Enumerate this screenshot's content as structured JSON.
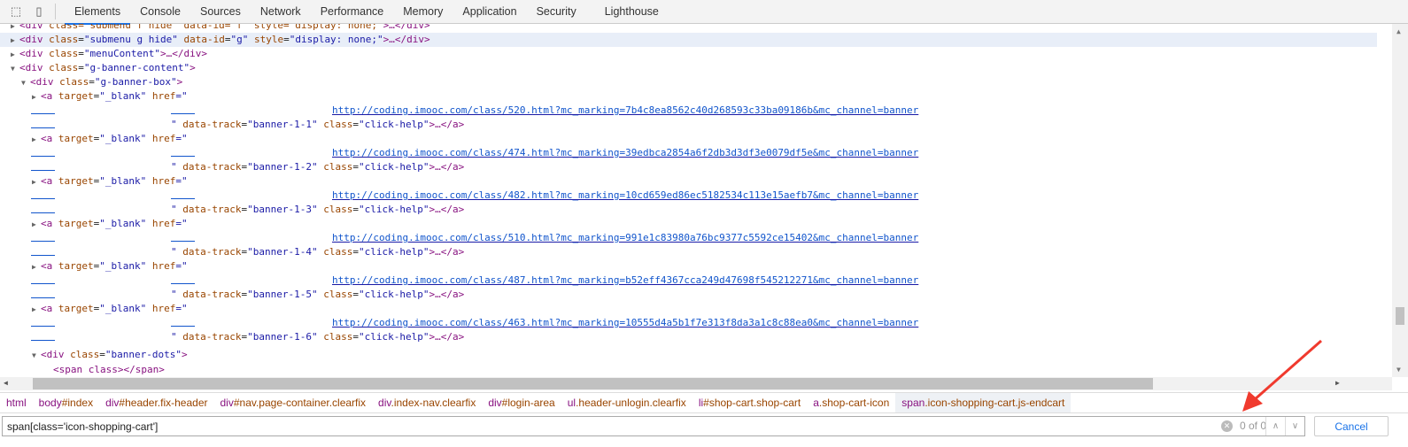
{
  "toolbar": {
    "icons": [
      "inspect-icon",
      "device-toolbar-icon"
    ],
    "tabs": [
      "Elements",
      "Console",
      "Sources",
      "Network",
      "Performance",
      "Memory",
      "Application",
      "Security",
      "Lighthouse"
    ],
    "active": "Elements"
  },
  "tree": {
    "line0": {
      "tag": "div",
      "attrs": "class=\"submenu f hide\" data-id=\"f\" style=\"display: none;\"",
      "tail": ">…</div>"
    },
    "line1": {
      "open": "<div ",
      "a1": "class",
      "v1": "\"submenu g hide\"",
      "a2": "data-id",
      "v2": "\"g\"",
      "a3": "style",
      "v3": "\"display: none;\"",
      "close": ">…</div>"
    },
    "line2": {
      "open": "<div ",
      "a1": "class",
      "v1": "\"menuContent\"",
      "close": ">…</div>"
    },
    "line3": {
      "open": "<div ",
      "a1": "class",
      "v1": "\"g-banner-content\"",
      "close": ">"
    },
    "line4": {
      "open": "<div ",
      "a1": "class",
      "v1": "\"g-banner-box\"",
      "close": ">"
    },
    "anchor_open": "<a ",
    "target_attr": "target",
    "target_val": "\"_blank\"",
    "href_attr": "href",
    "href_open": "=\"",
    "href_close": "\" ",
    "track_attr": "data-track",
    "class_attr": "class",
    "class_val": "\"click-help\"",
    "anchor_close": ">…</a>",
    "banners": [
      {
        "url": "http://coding.imooc.com/class/520.html?mc_marking=7b4c8ea8562c40d268593c33ba09186b&mc_channel=banner",
        "track": "\"banner-1-1\""
      },
      {
        "url": "http://coding.imooc.com/class/474.html?mc_marking=39edbca2854a6f2db3d3df3e0079df5e&mc_channel=banner",
        "track": "\"banner-1-2\""
      },
      {
        "url": "http://coding.imooc.com/class/482.html?mc_marking=10cd659ed86ec5182534c113e15aefb7&mc_channel=banner",
        "track": "\"banner-1-3\""
      },
      {
        "url": "http://coding.imooc.com/class/510.html?mc_marking=991e1c83980a76bc9377c5592ce15402&mc_channel=banner",
        "track": "\"banner-1-4\""
      },
      {
        "url": "http://coding.imooc.com/class/487.html?mc_marking=b52eff4367cca249d47698f545212271&mc_channel=banner",
        "track": "\"banner-1-5\""
      },
      {
        "url": "http://coding.imooc.com/class/463.html?mc_marking=10555d4a5b1f7e313f8da3a1c8c88ea0&mc_channel=banner",
        "track": "\"banner-1-6\""
      }
    ],
    "dots": {
      "open": "<div ",
      "a1": "class",
      "v1": "\"banner-dots\"",
      "close": ">"
    },
    "span": {
      "text": "<span class></span>"
    }
  },
  "breadcrumbs": [
    {
      "t": "html",
      "r": ""
    },
    {
      "t": "body",
      "r": "#index"
    },
    {
      "t": "div",
      "r": "#header.fix-header"
    },
    {
      "t": "div",
      "r": "#nav.page-container.clearfix"
    },
    {
      "t": "div",
      "r": ".index-nav.clearfix"
    },
    {
      "t": "div",
      "r": "#login-area"
    },
    {
      "t": "ul",
      "r": ".header-unlogin.clearfix"
    },
    {
      "t": "li",
      "r": "#shop-cart.shop-cart"
    },
    {
      "t": "a",
      "r": ".shop-cart-icon"
    },
    {
      "t": "span",
      "r": ".icon-shopping-cart.js-endcart"
    }
  ],
  "search": {
    "value": "span[class='icon-shopping-cart']",
    "count": "0 of 0",
    "cancel": "Cancel"
  },
  "annotation_color": "#f03a2e"
}
